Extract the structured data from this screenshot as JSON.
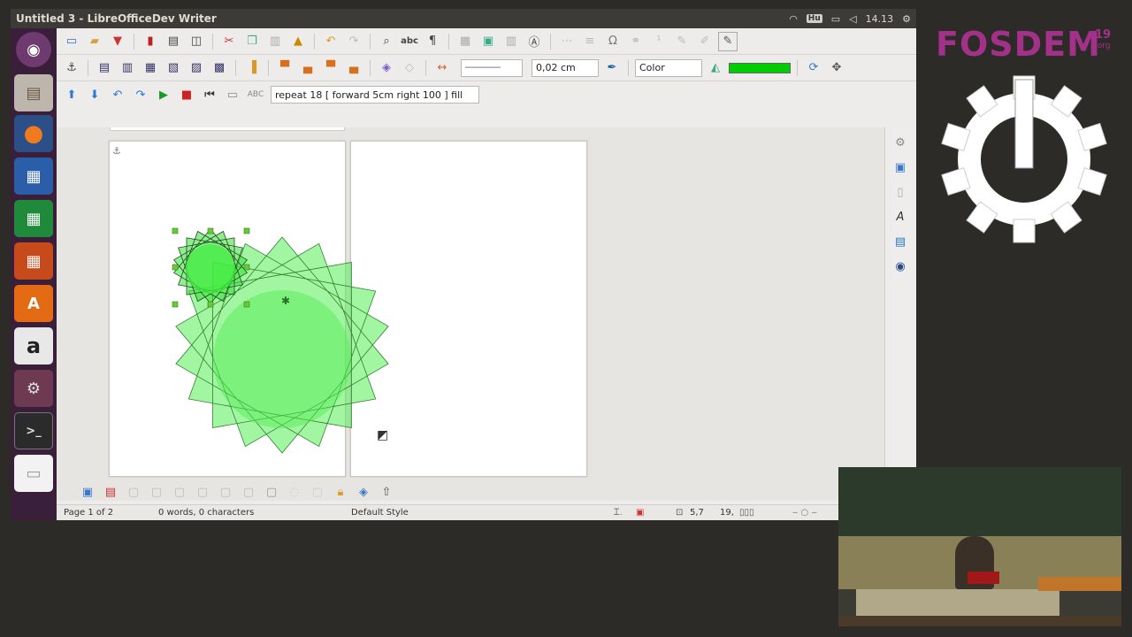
{
  "window_title": "Untitled 3 - LibreOfficeDev Writer",
  "topbar": {
    "keyboard": "Hu",
    "clock": "14.13"
  },
  "launcher": {
    "items": [
      {
        "name": "ubuntu-dash",
        "glyph": "◉"
      },
      {
        "name": "files",
        "glyph": "▤"
      },
      {
        "name": "firefox",
        "glyph": "●"
      },
      {
        "name": "writer",
        "glyph": "▦"
      },
      {
        "name": "calc",
        "glyph": "▦"
      },
      {
        "name": "impress",
        "glyph": "▦"
      },
      {
        "name": "software-center",
        "glyph": "A"
      },
      {
        "name": "amazon",
        "glyph": "a"
      },
      {
        "name": "system-settings",
        "glyph": "⚙"
      },
      {
        "name": "terminal",
        "glyph": ">_"
      },
      {
        "name": "document",
        "glyph": "▭"
      }
    ]
  },
  "toolbar3": {
    "command": "repeat 18 [ forward 5cm right 100 ] fill"
  },
  "properties": {
    "line_width": "0,02 cm",
    "area_style": "Color",
    "fill_color": "#00cc00"
  },
  "status": {
    "page": "Page 1 of 2",
    "words": "0 words, 0 characters",
    "style": "Default Style",
    "position": "5,7",
    "size": "19,"
  },
  "branding": {
    "logo": "FOSDEM",
    "year_top": "19",
    "year_bottom": ".org"
  },
  "colors": {
    "shape_fill": "#55ee55",
    "shape_stroke": "#2f7f2f",
    "handle": "#66cc33",
    "brand": "#a3318a"
  }
}
